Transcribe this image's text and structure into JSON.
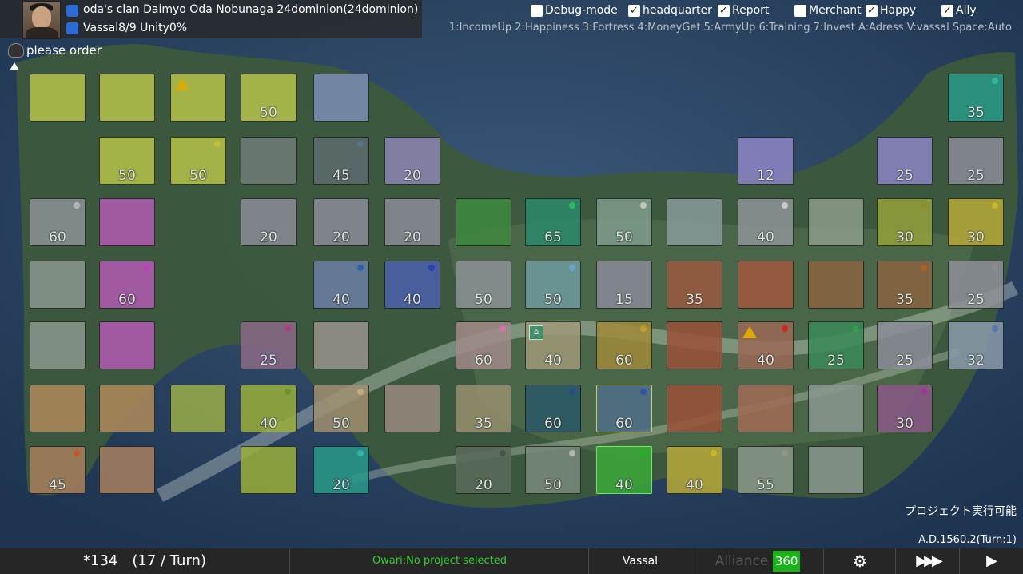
{
  "header": {
    "clan_line": "oda's clan Daimyo Oda Nobunaga 24dominion(24dominion)",
    "clan_icon": "info-icon",
    "vassal_line": "Vassal8/9 Unity0%"
  },
  "checkboxes": [
    {
      "label": "Debug-mode",
      "checked": false
    },
    {
      "label": "headquarter",
      "checked": true
    },
    {
      "label": "Report",
      "checked": true
    },
    {
      "label": "Merchant",
      "checked": false
    },
    {
      "label": "Happy",
      "checked": true
    },
    {
      "label": "Ally",
      "checked": true
    }
  ],
  "keys_help": "1:IncomeUp 2:Happiness 3:Fortress 4:MoneyGet 5:ArmyUp 6:Training 7:Invest A:Adress V:vassal Space:Auto",
  "order_text": "please order",
  "project_status": "プロジェクト実行可能",
  "date": "A.D.1560.2(Turn:1)",
  "bottom": {
    "income": "*134　(17 / Turn)",
    "project": "Owari:No project selected",
    "vassal": "Vassal",
    "alliance_label": "Alliance",
    "alliance_value": "360"
  },
  "colors": {
    "accent_green": "#1bb31b",
    "project_text": "#2fd12f",
    "checkbox_bg": "#ffffff"
  },
  "tiles": [
    {
      "row": 0,
      "col": 0,
      "color": "#b7c34a",
      "num": ""
    },
    {
      "row": 0,
      "col": 1,
      "color": "#b7c34a",
      "num": ""
    },
    {
      "row": 0,
      "col": 2,
      "color": "#b7c34a",
      "num": "",
      "icon": "warning-icon"
    },
    {
      "row": 0,
      "col": 3,
      "color": "#b7c34a",
      "num": "50"
    },
    {
      "row": 0,
      "col": 4,
      "color": "#7a8fb4",
      "num": ""
    },
    {
      "row": 0,
      "col": 13,
      "color": "#2a9a8a",
      "num": "35",
      "dot": "#2ec9b0"
    },
    {
      "row": 1,
      "col": 1,
      "color": "#b7c34a",
      "num": "50"
    },
    {
      "row": 1,
      "col": 2,
      "color": "#b7c34a",
      "num": "50",
      "dot": "#d9d23a"
    },
    {
      "row": 1,
      "col": 3,
      "color": "#6f7d78",
      "num": ""
    },
    {
      "row": 1,
      "col": 4,
      "color": "#5e6b6f",
      "num": "45",
      "dot": "#5d7898"
    },
    {
      "row": 1,
      "col": 5,
      "color": "#8e86b3",
      "num": "20"
    },
    {
      "row": 1,
      "col": 10,
      "color": "#8e86c7",
      "num": "12"
    },
    {
      "row": 1,
      "col": 12,
      "color": "#8e86c7",
      "num": "25"
    },
    {
      "row": 1,
      "col": 13,
      "color": "#8a8c98",
      "num": "25"
    },
    {
      "row": 2,
      "col": 0,
      "color": "#8a9296",
      "num": "60",
      "dot": "#c8c8c8"
    },
    {
      "row": 2,
      "col": 1,
      "color": "#b35ab3",
      "num": ""
    },
    {
      "row": 2,
      "col": 3,
      "color": "#8a8c98",
      "num": "20"
    },
    {
      "row": 2,
      "col": 4,
      "color": "#8a8c98",
      "num": "20"
    },
    {
      "row": 2,
      "col": 5,
      "color": "#8a8c98",
      "num": "20"
    },
    {
      "row": 2,
      "col": 6,
      "color": "#3f8a3f",
      "num": ""
    },
    {
      "row": 2,
      "col": 7,
      "color": "#2a8a6a",
      "num": "65",
      "dot": "#2ec96a"
    },
    {
      "row": 2,
      "col": 8,
      "color": "#7f9d8d",
      "num": "50",
      "dot": "#d8d8d8"
    },
    {
      "row": 2,
      "col": 9,
      "color": "#8a9a9a",
      "num": ""
    },
    {
      "row": 2,
      "col": 10,
      "color": "#8e9698",
      "num": "40",
      "dot": "#e0e0e0"
    },
    {
      "row": 2,
      "col": 11,
      "color": "#8d9c8a",
      "num": ""
    },
    {
      "row": 2,
      "col": 12,
      "color": "#95a03d",
      "num": "30",
      "dot": "#9a9a2a"
    },
    {
      "row": 2,
      "col": 13,
      "color": "#b8aa3a",
      "num": "30",
      "dot": "#e0c820"
    },
    {
      "row": 3,
      "col": 0,
      "color": "#8a9890",
      "num": ""
    },
    {
      "row": 3,
      "col": 1,
      "color": "#b35ab3",
      "num": "60",
      "dot": "#d040d0"
    },
    {
      "row": 3,
      "col": 4,
      "color": "#6a7fa5",
      "num": "40",
      "dot": "#3060c0"
    },
    {
      "row": 3,
      "col": 5,
      "color": "#4b5fae",
      "num": "40",
      "dot": "#2040c0"
    },
    {
      "row": 3,
      "col": 6,
      "color": "#8a9296",
      "num": "50"
    },
    {
      "row": 3,
      "col": 7,
      "color": "#6f9aa0",
      "num": "50",
      "dot": "#70b0e0"
    },
    {
      "row": 3,
      "col": 8,
      "color": "#8a8a98",
      "num": "15"
    },
    {
      "row": 3,
      "col": 9,
      "color": "#9a5a40",
      "num": "35"
    },
    {
      "row": 3,
      "col": 10,
      "color": "#a0583e",
      "num": ""
    },
    {
      "row": 3,
      "col": 11,
      "color": "#8a6440",
      "num": ""
    },
    {
      "row": 3,
      "col": 12,
      "color": "#8a6440",
      "num": "35",
      "dot": "#c06020"
    },
    {
      "row": 3,
      "col": 13,
      "color": "#8e9098",
      "num": "25",
      "dot": "#a090a0"
    },
    {
      "row": 4,
      "col": 0,
      "color": "#8a9890",
      "num": ""
    },
    {
      "row": 4,
      "col": 1,
      "color": "#b35ab3",
      "num": ""
    },
    {
      "row": 4,
      "col": 3,
      "color": "#8a6a88",
      "num": "25",
      "dot": "#c04090"
    },
    {
      "row": 4,
      "col": 4,
      "color": "#98948a",
      "num": ""
    },
    {
      "row": 4,
      "col": 6,
      "color": "#a08a88",
      "num": "60",
      "dot": "#e070b0"
    },
    {
      "row": 4,
      "col": 7,
      "color": "#a09a78",
      "num": "40",
      "icon": "headquarter-icon"
    },
    {
      "row": 4,
      "col": 8,
      "color": "#a08a3a",
      "num": "60",
      "dot": "#d0a020"
    },
    {
      "row": 4,
      "col": 9,
      "color": "#9a5238",
      "num": ""
    },
    {
      "row": 4,
      "col": 10,
      "color": "#9a6a55",
      "num": "40",
      "dot": "#e02020",
      "icon": "warning-icon"
    },
    {
      "row": 4,
      "col": 11,
      "color": "#3a8a58",
      "num": "25",
      "dot": "#30a050"
    },
    {
      "row": 4,
      "col": 12,
      "color": "#8a8c98",
      "num": "25"
    },
    {
      "row": 4,
      "col": 13,
      "color": "#8a9aaa",
      "num": "32",
      "dot": "#6080c0"
    },
    {
      "row": 5,
      "col": 0,
      "color": "#b08a5a",
      "num": ""
    },
    {
      "row": 5,
      "col": 1,
      "color": "#b08a5a",
      "num": ""
    },
    {
      "row": 5,
      "col": 2,
      "color": "#9aae4a",
      "num": ""
    },
    {
      "row": 5,
      "col": 3,
      "color": "#9aae3a",
      "num": "40",
      "dot": "#7aa020"
    },
    {
      "row": 5,
      "col": 4,
      "color": "#a09070",
      "num": "50",
      "dot": "#d0b080"
    },
    {
      "row": 5,
      "col": 5,
      "color": "#9a8a80",
      "num": ""
    },
    {
      "row": 5,
      "col": 6,
      "color": "#98906e",
      "num": "35"
    },
    {
      "row": 5,
      "col": 7,
      "color": "#2a5a68",
      "num": "60",
      "dot": "#204a90"
    },
    {
      "row": 5,
      "col": 8,
      "color": "#50708a",
      "num": "60",
      "dot": "#3050b0",
      "selected": "yellow"
    },
    {
      "row": 5,
      "col": 9,
      "color": "#9a5238",
      "num": ""
    },
    {
      "row": 5,
      "col": 10,
      "color": "#a06a55",
      "num": ""
    },
    {
      "row": 5,
      "col": 11,
      "color": "#8a9890",
      "num": ""
    },
    {
      "row": 5,
      "col": 12,
      "color": "#8a5a88",
      "num": "30",
      "dot": "#b030b0"
    },
    {
      "row": 6,
      "col": 0,
      "color": "#a88060",
      "num": "45",
      "dot": "#d06020"
    },
    {
      "row": 6,
      "col": 1,
      "color": "#a88060",
      "num": ""
    },
    {
      "row": 6,
      "col": 3,
      "color": "#9aae3a",
      "num": ""
    },
    {
      "row": 6,
      "col": 4,
      "color": "#2a9a8a",
      "num": "20",
      "dot": "#2ec9b0"
    },
    {
      "row": 6,
      "col": 6,
      "color": "#5a6a5a",
      "num": "20",
      "dot": "#405040"
    },
    {
      "row": 6,
      "col": 7,
      "color": "#7a8a7a",
      "num": "50",
      "dot": "#c8c8c8"
    },
    {
      "row": 6,
      "col": 8,
      "color": "#3aaa3a",
      "num": "40",
      "dot": "#20c020",
      "selected": "green"
    },
    {
      "row": 6,
      "col": 9,
      "color": "#b8aa3a",
      "num": "40",
      "dot": "#e0c820"
    },
    {
      "row": 6,
      "col": 10,
      "color": "#8a9a88",
      "num": "55",
      "dot": "#a0a0a0"
    },
    {
      "row": 6,
      "col": 11,
      "color": "#8a9890",
      "num": ""
    }
  ]
}
